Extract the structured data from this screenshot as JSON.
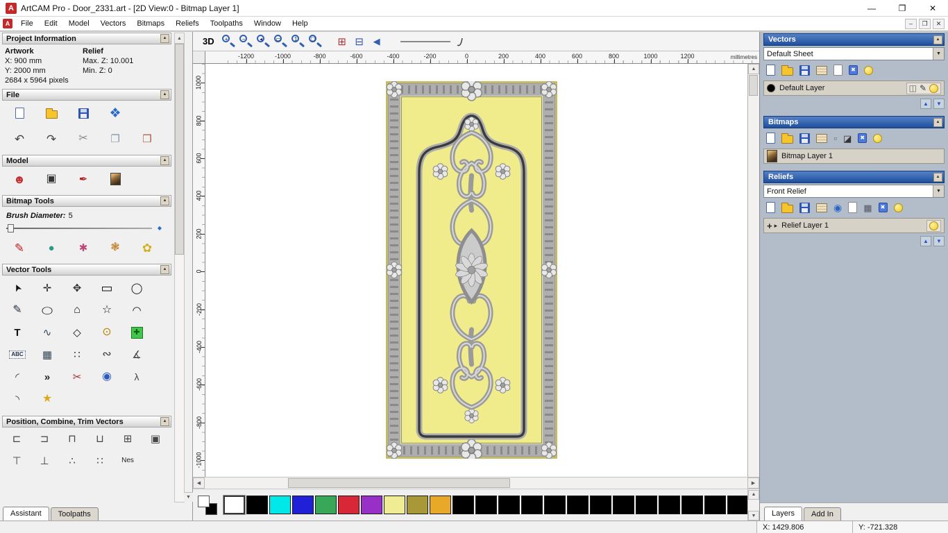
{
  "window": {
    "title": "ArtCAM Pro - Door_2331.art - [2D View:0 - Bitmap Layer 1]",
    "logo_letter": "A",
    "minimize": "—",
    "maximize": "❐",
    "close": "✕",
    "mdi_minimize": "–",
    "mdi_restore": "❐",
    "mdi_close": "✕"
  },
  "ui": {
    "collapse": "▲"
  },
  "scroll": {
    "up": "▲",
    "down": "▼",
    "left": "◀",
    "right": "▶"
  },
  "menu": {
    "items": [
      "File",
      "Edit",
      "Model",
      "Vectors",
      "Bitmaps",
      "Reliefs",
      "Toolpaths",
      "Window",
      "Help"
    ]
  },
  "left_panel": {
    "project_info": {
      "title": "Project Information",
      "artwork_label": "Artwork",
      "relief_label": "Relief",
      "x": "X: 900 mm",
      "y": "Y: 2000 mm",
      "max_z": "Max. Z: 10.001",
      "min_z": "Min. Z: 0",
      "pixels": "2684 x 5964 pixels"
    },
    "file_section": {
      "title": "File",
      "row1": [
        {
          "name": "new-model-icon",
          "cls": "icg pg"
        },
        {
          "name": "open-model-icon",
          "cls": "icg fld"
        },
        {
          "name": "save-model-icon",
          "cls": "icg flp"
        },
        {
          "name": "export-model-icon",
          "cls": "icg",
          "glyph": "❖",
          "style": "color:#2a6ac8;font-size:19px"
        }
      ],
      "row2": [
        {
          "name": "undo-icon",
          "cls": "icg",
          "glyph": "↶",
          "style": "color:#444;font-size:17px"
        },
        {
          "name": "redo-icon",
          "cls": "icg",
          "glyph": "↷",
          "style": "color:#444;font-size:17px"
        },
        {
          "name": "cut-icon",
          "cls": "icg",
          "glyph": "✂",
          "style": "color:#888;font-size:16px"
        },
        {
          "name": "copy-icon",
          "cls": "icg",
          "glyph": "❐",
          "style": "color:#8899aa;font-size:15px"
        },
        {
          "name": "paste-icon",
          "cls": "icg",
          "glyph": "❒",
          "style": "color:#b05838;font-size:15px"
        }
      ]
    },
    "model_section": {
      "title": "Model",
      "row": [
        {
          "name": "greyscale-view-icon",
          "cls": "icg",
          "glyph": "☻",
          "style": "color:#c03030;font-size:17px"
        },
        {
          "name": "shaded-view-icon",
          "cls": "icg",
          "glyph": "▣",
          "style": "color:#333;font-size:16px"
        },
        {
          "name": "stamp-relief-icon",
          "cls": "icg",
          "glyph": "✒",
          "style": "color:#b02020;font-size:15px"
        },
        {
          "name": "texture-image-icon",
          "cls": "icg ml"
        }
      ]
    },
    "bitmap_tools": {
      "title": "Bitmap Tools",
      "brush_label": "Brush Diameter:",
      "brush_value": "5",
      "row": [
        {
          "name": "draw-brush-icon",
          "cls": "icg",
          "glyph": "✎",
          "style": "color:#c02020;font-size:17px"
        },
        {
          "name": "paint-block-icon",
          "cls": "icg",
          "glyph": "●",
          "style": "color:#2e9a86;font-size:15px"
        },
        {
          "name": "spray-brush-icon",
          "cls": "icg",
          "glyph": "✱",
          "style": "color:#c04878;font-size:15px"
        },
        {
          "name": "colour-palette-icon",
          "cls": "icg",
          "glyph": "❃",
          "style": "color:#c08028;font-size:16px"
        },
        {
          "name": "flood-fill-icon",
          "cls": "icg",
          "glyph": "✿",
          "style": "color:#d4b020;font-size:17px"
        }
      ]
    },
    "vector_tools": {
      "title": "Vector Tools",
      "items": [
        {
          "name": "select-vectors-icon",
          "cls": "icg",
          "glyph": "➤",
          "style": "color:#111;display:inline-block;transform:rotate(-115deg);font-size:14px"
        },
        {
          "name": "node-editing-icon",
          "cls": "icg",
          "glyph": "✛",
          "style": "color:#222"
        },
        {
          "name": "transform-vectors-icon",
          "cls": "icg",
          "glyph": "✥",
          "style": "color:#333"
        },
        {
          "name": "create-rectangle-icon",
          "cls": "icg",
          "glyph": "▭",
          "style": "color:#111;font-size:18px"
        },
        {
          "name": "create-circle-icon",
          "cls": "icg",
          "glyph": "◯",
          "style": "color:#111"
        },
        {
          "name": "create-polyline-icon",
          "cls": "icg",
          "glyph": "✎",
          "style": "color:#234;font-size:16px"
        },
        {
          "name": "create-ellipse-icon",
          "cls": "icg",
          "glyph": "◯",
          "style": "color:#111;display:inline-block;transform:scaleY(.72)"
        },
        {
          "name": "create-polygon-icon",
          "cls": "icg",
          "glyph": "⌂",
          "style": "color:#111;font-size:16px"
        },
        {
          "name": "create-star-icon",
          "cls": "icg",
          "glyph": "☆",
          "style": "color:#111;font-size:16px"
        },
        {
          "name": "create-arc-icon",
          "cls": "icg",
          "glyph": "◠",
          "style": "color:#111"
        },
        {
          "name": "create-text-icon",
          "cls": "icg",
          "glyph": "T",
          "style": "color:#111;font-weight:bold;font-size:15px"
        },
        {
          "name": "wrap-text-icon",
          "cls": "icg",
          "glyph": "∿",
          "style": "color:#345"
        },
        {
          "name": "envelope-distort-icon",
          "cls": "icg",
          "glyph": "◇",
          "style": "color:#111"
        },
        {
          "name": "offset-vectors-icon",
          "cls": "icg",
          "glyph": "⊙",
          "style": "color:#b8860b;font-size:16px"
        },
        {
          "name": "paste-vectors-icon",
          "cls": "icg gplus",
          "glyph": "✚"
        },
        {
          "name": "text-block-icon",
          "cls": "icg abc",
          "glyph": "ABC"
        },
        {
          "name": "grid-tool-icon",
          "cls": "icg",
          "glyph": "▦",
          "style": "color:#345"
        },
        {
          "name": "block-copy-icon",
          "cls": "icg",
          "glyph": "∷",
          "style": "color:#333;font-size:15px"
        },
        {
          "name": "fit-curve-icon",
          "cls": "icg",
          "glyph": "∾",
          "style": "color:#333;font-size:16px"
        },
        {
          "name": "measure-tool-icon",
          "cls": "icg",
          "glyph": "∡",
          "style": "color:#444;font-size:15px"
        },
        {
          "name": "arc-through-points-icon",
          "cls": "icg",
          "glyph": "◜",
          "style": "color:#333"
        },
        {
          "name": "join-vectors-icon",
          "cls": "icg",
          "glyph": "»",
          "style": "color:#222;font-weight:bold;font-size:15px"
        },
        {
          "name": "trim-vectors-icon",
          "cls": "icg",
          "glyph": "✂",
          "style": "color:#a03030;font-size:15px"
        },
        {
          "name": "extrude-vector-icon",
          "cls": "icg",
          "glyph": "◉",
          "style": "color:#2a5ac0;font-size:16px"
        },
        {
          "name": "vector-doctor-icon",
          "cls": "icg",
          "glyph": "λ",
          "style": "color:#444;font-size:14px"
        },
        {
          "name": "fillet-corner-icon",
          "cls": "icg",
          "glyph": "◝",
          "style": "color:#333"
        },
        {
          "name": "wrap-vectors-icon",
          "cls": "icg",
          "glyph": "★",
          "style": "color:#e0a818;font-size:16px"
        }
      ]
    },
    "position_section": {
      "title": "Position, Combine, Trim Vectors",
      "items": [
        {
          "name": "align-left-icon",
          "cls": "icg",
          "glyph": "⊏",
          "style": "color:#444"
        },
        {
          "name": "align-right-icon",
          "cls": "icg",
          "glyph": "⊐",
          "style": "color:#444"
        },
        {
          "name": "align-top-icon",
          "cls": "icg",
          "glyph": "⊓",
          "style": "color:#444"
        },
        {
          "name": "align-bottom-icon",
          "cls": "icg",
          "glyph": "⊔",
          "style": "color:#444"
        },
        {
          "name": "center-in-page-icon",
          "cls": "icg",
          "glyph": "⊞",
          "style": "color:#444"
        },
        {
          "name": "align-centers-icon",
          "cls": "icg",
          "glyph": "▣",
          "style": "color:#444"
        },
        {
          "name": "paste-array-icon",
          "cls": "icg",
          "glyph": "⊤",
          "style": "color:#444"
        },
        {
          "name": "paste-rotated-icon",
          "cls": "icg",
          "glyph": "⊥",
          "style": "color:#444"
        },
        {
          "name": "scatter-copies-icon",
          "cls": "icg",
          "glyph": "∴",
          "style": "color:#444"
        },
        {
          "name": "array-copies-icon",
          "cls": "icg",
          "glyph": "∷",
          "style": "color:#444"
        },
        {
          "name": "nesting-icon",
          "cls": "icg",
          "glyph": "Nes",
          "style": "color:#222;font-size:10px"
        }
      ]
    },
    "tabs": [
      {
        "label": "Assistant"
      },
      {
        "label": "Toolpaths"
      }
    ]
  },
  "toolbar": {
    "view3d": "3D",
    "zoom": [
      {
        "name": "zoom-in-icon",
        "glyph": "+"
      },
      {
        "name": "zoom-out-icon",
        "glyph": "−"
      },
      {
        "name": "zoom-previous-icon",
        "glyph": "◂"
      },
      {
        "name": "zoom-window-icon",
        "glyph": "▭"
      },
      {
        "name": "zoom-1to1-icon",
        "glyph": "1"
      },
      {
        "name": "zoom-fit-page-icon",
        "glyph": "❏"
      }
    ],
    "toggles": [
      {
        "name": "previous-bitmap-layer-icon",
        "glyph": "⊞",
        "style": "color:#b03030;font-size:15px"
      },
      {
        "name": "next-bitmap-layer-icon",
        "glyph": "⊟",
        "style": "color:#3050b0;font-size:15px"
      },
      {
        "name": "view-back-icon",
        "glyph": "◀",
        "style": "color:#3060b0;font-size:13px"
      }
    ]
  },
  "ruler": {
    "h_ticks": [
      "-1200",
      "-1000",
      "-800",
      "-600",
      "-400",
      "-200",
      "0",
      "200",
      "400",
      "600",
      "800",
      "1000",
      "1200"
    ],
    "v_ticks": [
      "1000",
      "800",
      "600",
      "400",
      "200",
      "0",
      "-200",
      "-400",
      "-600",
      "-800",
      "-1000"
    ],
    "units": "millimetres"
  },
  "artwork": {
    "colors": {
      "door-yellow": "#f1ec8b",
      "door-border-gray": "#aeaeae",
      "door-frame": "#3b3b3b",
      "ornament-gray": "#9a9a9a"
    }
  },
  "palette": {
    "colors": [
      "#ffffff",
      "#000000",
      "#00e8e8",
      "#2020d8",
      "#38a858",
      "#d82838",
      "#9830c8",
      "#f0ec94",
      "#a89838",
      "#e8a828",
      "#000000",
      "#000000",
      "#000000",
      "#000000",
      "#000000",
      "#000000",
      "#000000",
      "#000000",
      "#000000",
      "#000000",
      "#000000",
      "#000000",
      "#000000"
    ]
  },
  "right_panel": {
    "up": "▲",
    "down": "▼",
    "vectors": {
      "title": "Vectors",
      "sheet_value": "Default Sheet",
      "toolbar": [
        {
          "name": "new-vector-layer-icon",
          "cls": "icg pg"
        },
        {
          "name": "open-vector-layer-icon",
          "cls": "icg fld"
        },
        {
          "name": "save-vector-layer-icon",
          "cls": "icg flp"
        },
        {
          "name": "merge-vector-layers-icon",
          "cls": "icg stk"
        },
        {
          "name": "new-sheet-icon",
          "cls": "icg pg2"
        },
        {
          "name": "delete-vector-layer-icon",
          "cls": "icg trs",
          "glyph": "✖"
        },
        {
          "name": "toggle-all-vectors-icon",
          "cls": "icg blb"
        }
      ],
      "layer": {
        "name": "Default Layer",
        "swatch": "#000000"
      },
      "layer_icons": [
        {
          "name": "lock-layer-icon",
          "cls": "icg",
          "glyph": "◫",
          "style": "color:#566;font-size:12px"
        },
        {
          "name": "edit-layer-icon",
          "cls": "icg",
          "glyph": "✎",
          "style": "color:#334;font-size:12px"
        },
        {
          "name": "layer-visibility-icon",
          "cls": "icg blb"
        }
      ]
    },
    "bitmaps": {
      "title": "Bitmaps",
      "toolbar": [
        {
          "name": "new-bitmap-layer-icon",
          "cls": "icg pg"
        },
        {
          "name": "open-bitmap-layer-icon",
          "cls": "icg fld"
        },
        {
          "name": "save-bitmap-layer-icon",
          "cls": "icg flp"
        },
        {
          "name": "merge-bitmap-layers-icon",
          "cls": "icg stk"
        },
        {
          "name": "clear-bitmap-icon",
          "cls": "icg",
          "glyph": "▫",
          "style": "color:#667;font-size:14px"
        },
        {
          "name": "contrast-icon",
          "cls": "icg",
          "glyph": "◪",
          "style": "color:#333;font-size:13px"
        },
        {
          "name": "delete-bitmap-layer-icon",
          "cls": "icg trs",
          "glyph": "✖"
        },
        {
          "name": "toggle-all-bitmaps-icon",
          "cls": "icg blb"
        }
      ],
      "layer": {
        "name": "Bitmap Layer 1"
      }
    },
    "reliefs": {
      "title": "Reliefs",
      "relief_value": "Front Relief",
      "toolbar": [
        {
          "name": "new-relief-layer-icon",
          "cls": "icg pg"
        },
        {
          "name": "open-relief-layer-icon",
          "cls": "icg fld"
        },
        {
          "name": "save-relief-layer-icon",
          "cls": "icg flp"
        },
        {
          "name": "merge-relief-layers-icon",
          "cls": "icg stk"
        },
        {
          "name": "smooth-relief-icon",
          "cls": "icg",
          "glyph": "◉",
          "style": "color:#2a62c8;font-size:14px"
        },
        {
          "name": "new-relief-icon",
          "cls": "icg pg2"
        },
        {
          "name": "relief-grid-icon",
          "cls": "icg",
          "glyph": "▦",
          "style": "color:#556;font-size:13px"
        },
        {
          "name": "delete-relief-layer-icon",
          "cls": "icg trs",
          "glyph": "✖"
        },
        {
          "name": "toggle-all-reliefs-icon",
          "cls": "icg blb"
        }
      ],
      "layer": {
        "name": "Relief Layer 1"
      },
      "layer_icons_left": [
        {
          "name": "add-relief-layer-icon",
          "cls": "icg",
          "glyph": "+",
          "style": "color:#222;font-weight:bold;font-size:13px"
        },
        {
          "name": "expand-layer-icon",
          "cls": "icg",
          "glyph": "▸",
          "style": "color:#222;font-size:9px"
        }
      ],
      "layer_icons": [
        {
          "name": "relief-visibility-icon",
          "cls": "icg blb"
        }
      ]
    },
    "tabs": [
      {
        "label": "Layers"
      },
      {
        "label": "Add In"
      }
    ]
  },
  "status": {
    "x": "X: 1429.806",
    "y": "Y: -721.328"
  }
}
